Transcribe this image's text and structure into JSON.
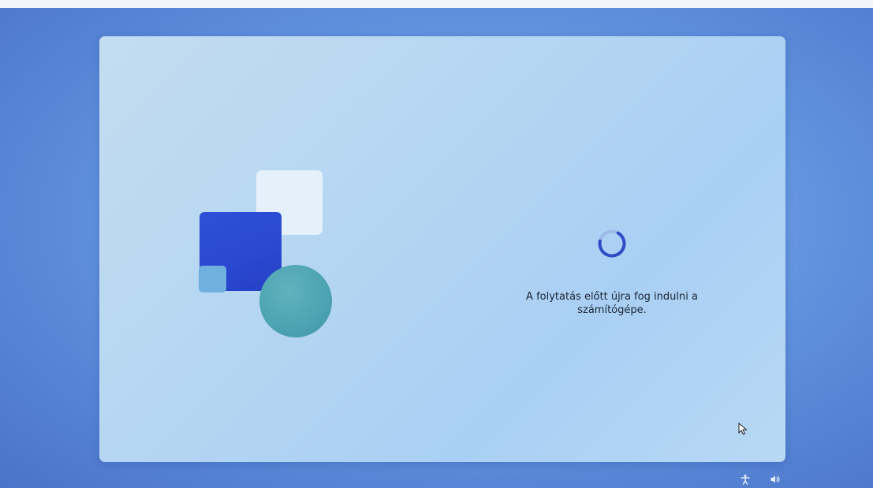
{
  "setup": {
    "status_line_1": "A folytatás előtt újra fog indulni a",
    "status_line_2": "számítógépe."
  },
  "spinner": {
    "progress": 0.7,
    "color": "#2f4bc6"
  },
  "illustration": {
    "colors": {
      "white_square": "#ecf4fc",
      "blue_square": "#2f4fd8",
      "small_square": "#6fb0de",
      "teal_circle": "#4da3b2"
    }
  },
  "tray": {
    "icons": [
      "accessibility-icon",
      "volume-icon"
    ]
  }
}
